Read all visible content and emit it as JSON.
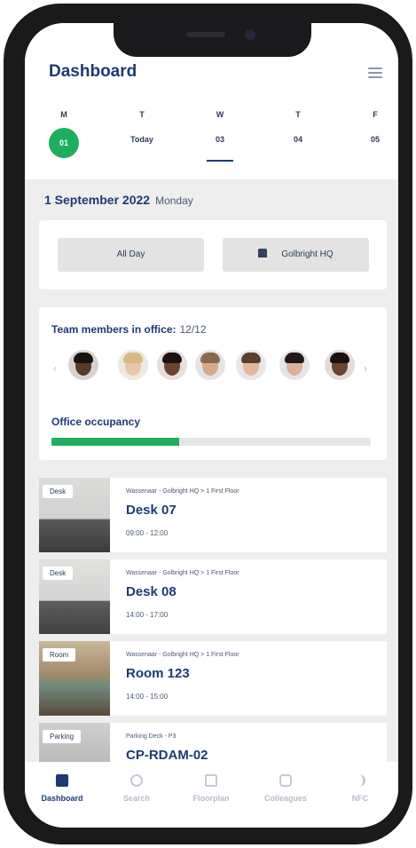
{
  "header": {
    "title": "Dashboard",
    "menu_icon": "hamburger-menu-icon"
  },
  "days": [
    {
      "name": "M",
      "value": "01",
      "selected": true
    },
    {
      "name": "T",
      "value": "Today"
    },
    {
      "name": "W",
      "value": "03",
      "underlined": true
    },
    {
      "name": "T",
      "value": "04"
    },
    {
      "name": "F",
      "value": "05"
    }
  ],
  "date": {
    "full": "1 September 2022",
    "weekday": "Monday"
  },
  "filters": {
    "time": "All Day",
    "location": "Golbright HQ",
    "location_icon": "building-icon"
  },
  "team": {
    "label": "Team members in office:",
    "count": "12/12",
    "prev_icon": "chevron-left-icon",
    "next_icon": "chevron-right-icon"
  },
  "occupancy": {
    "label": "Office occupancy",
    "fraction": 0.4
  },
  "bookings": [
    {
      "tag": "Desk",
      "location": "Wassenaar - Golbright HQ > 1 First Floor",
      "name": "Desk 07",
      "time": "09:00 - 12:00"
    },
    {
      "tag": "Desk",
      "location": "Wassenaar - Golbright HQ > 1 First Floor",
      "name": "Desk 08",
      "time": "14:00 - 17:00"
    },
    {
      "tag": "Room",
      "location": "Wassenaar - Golbright HQ > 1 First Floor",
      "name": "Room 123",
      "time": "14:00 - 15:00"
    },
    {
      "tag": "Parking",
      "location": "Parking Deck - P3",
      "name": "CP-RDAM-02",
      "time": ""
    }
  ],
  "tabs": [
    {
      "label": "Dashboard",
      "icon": "calendar-icon",
      "active": true
    },
    {
      "label": "Search",
      "icon": "search-icon"
    },
    {
      "label": "Floorplan",
      "icon": "floorplan-icon"
    },
    {
      "label": "Colleagues",
      "icon": "colleagues-icon"
    },
    {
      "label": "NFC",
      "icon": "nfc-icon"
    }
  ],
  "colors": {
    "accent": "#1fae5f",
    "primary": "#1d3a73",
    "inactive_tab": "#b5bcc8"
  }
}
